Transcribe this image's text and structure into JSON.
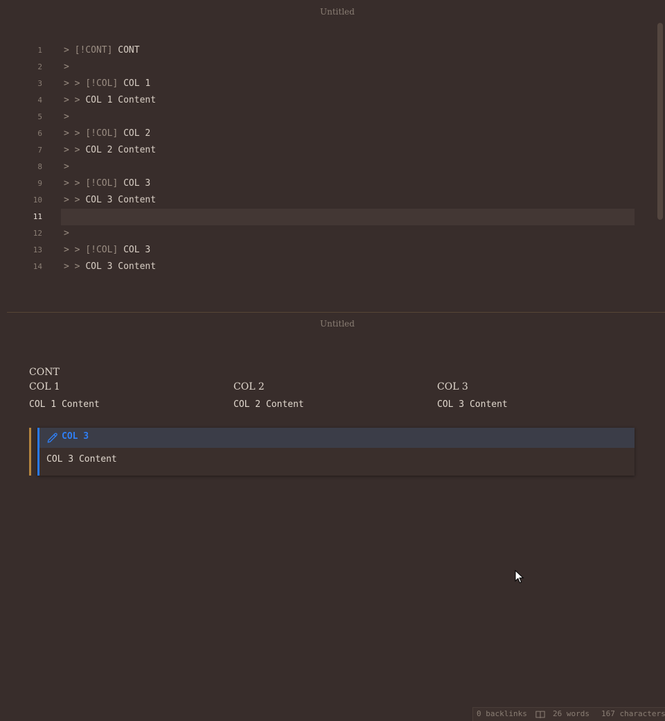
{
  "editor": {
    "title": "Untitled",
    "active_line": 11,
    "lines": [
      {
        "n": "1",
        "marker": "> [!CONT]",
        "text": " CONT"
      },
      {
        "n": "2",
        "marker": ">",
        "text": ""
      },
      {
        "n": "3",
        "marker": "> > [!COL]",
        "text": " COL 1"
      },
      {
        "n": "4",
        "marker": "> > ",
        "text": "COL 1 Content"
      },
      {
        "n": "5",
        "marker": ">",
        "text": ""
      },
      {
        "n": "6",
        "marker": "> > [!COL]",
        "text": " COL 2"
      },
      {
        "n": "7",
        "marker": "> > ",
        "text": "COL 2 Content"
      },
      {
        "n": "8",
        "marker": ">",
        "text": ""
      },
      {
        "n": "9",
        "marker": "> > [!COL]",
        "text": " COL 3"
      },
      {
        "n": "10",
        "marker": "> > ",
        "text": "COL 3 Content"
      },
      {
        "n": "11",
        "marker": "",
        "text": ""
      },
      {
        "n": "12",
        "marker": ">",
        "text": ""
      },
      {
        "n": "13",
        "marker": "> > [!COL]",
        "text": " COL 3"
      },
      {
        "n": "14",
        "marker": "> > ",
        "text": "COL 3 Content"
      }
    ]
  },
  "preview": {
    "title": "Untitled",
    "container_title": "CONT",
    "columns": [
      {
        "title": "COL 1",
        "content": "COL 1 Content"
      },
      {
        "title": "COL 2",
        "content": "COL 2 Content"
      },
      {
        "title": "COL 3",
        "content": "COL 3 Content"
      }
    ],
    "callout": {
      "icon": "pencil-icon",
      "title": "COL 3",
      "content": "COL 3 Content"
    }
  },
  "statusbar": {
    "backlinks": "0 backlinks",
    "words": "26 words",
    "characters": "167 characters",
    "book_icon": "book-icon"
  },
  "colors": {
    "background": "#382d2b",
    "callout_accent": "#2f7ff5",
    "outer_accent": "#b8873f"
  }
}
